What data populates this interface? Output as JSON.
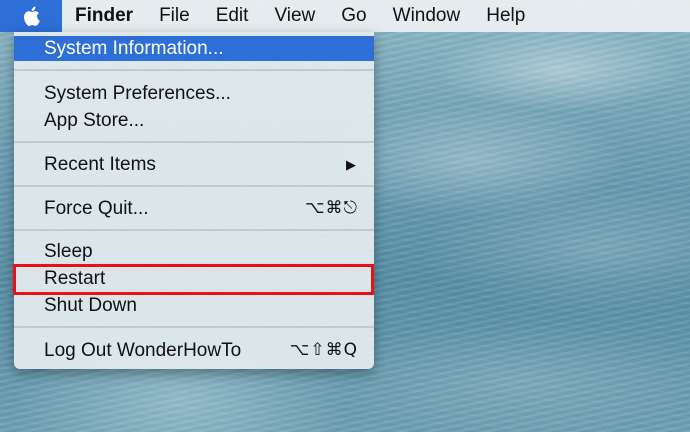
{
  "menubar": {
    "apple_icon": "apple-logo-icon",
    "items": [
      {
        "label": "Finder"
      },
      {
        "label": "File"
      },
      {
        "label": "Edit"
      },
      {
        "label": "View"
      },
      {
        "label": "Go"
      },
      {
        "label": "Window"
      },
      {
        "label": "Help"
      }
    ]
  },
  "apple_menu": {
    "items": [
      {
        "label": "System Information...",
        "highlighted": true
      },
      {
        "label": "System Preferences..."
      },
      {
        "label": "App Store..."
      },
      {
        "label": "Recent Items",
        "submenu": true,
        "arrow": "▶"
      },
      {
        "label": "Force Quit...",
        "shortcut": "⌥⌘⎋"
      },
      {
        "label": "Sleep"
      },
      {
        "label": "Restart",
        "annotated": true
      },
      {
        "label": "Shut Down"
      },
      {
        "label": "Log Out WonderHowTo",
        "shortcut": "⌥⇧⌘Q"
      }
    ]
  },
  "colors": {
    "highlight": "#2d6fd6",
    "annotation": "#e8111a"
  }
}
